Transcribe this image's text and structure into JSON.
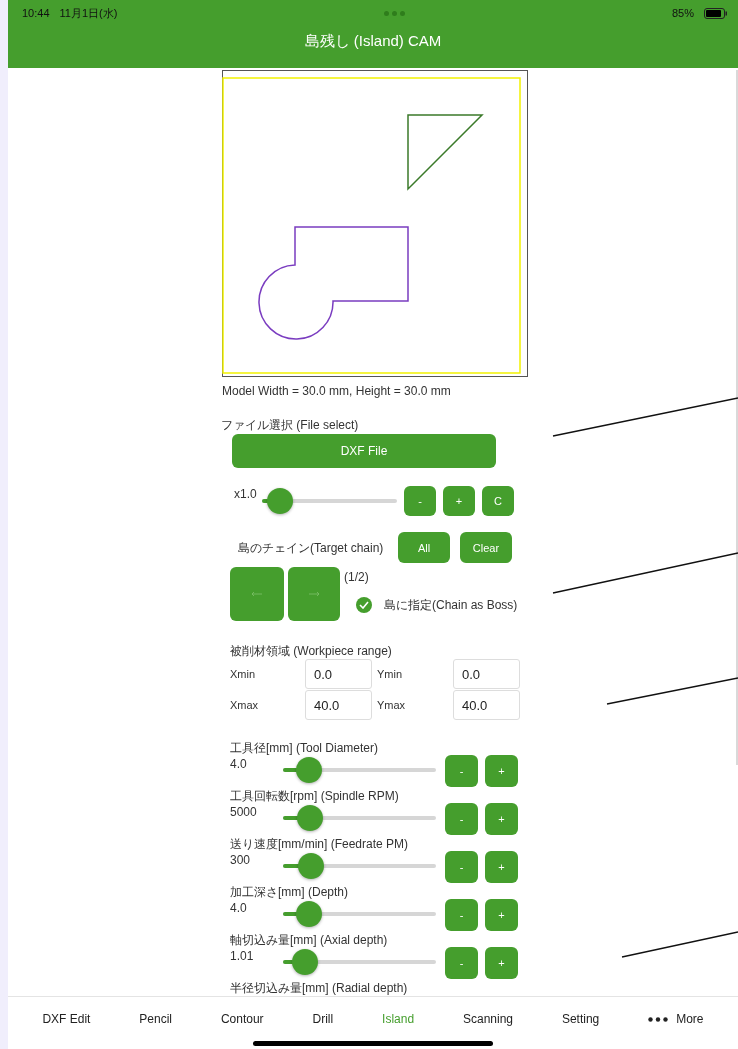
{
  "status_bar": {
    "time": "10:44",
    "date": "11月1日(水)",
    "battery": "85%"
  },
  "header": {
    "title": "島残し (Island) CAM"
  },
  "model_info": "Model Width = 30.0 mm, Height = 30.0 mm",
  "file_select": {
    "label": "ファイル選択 (File select)",
    "button": "DXF File"
  },
  "zoom": {
    "reading": "x1.0",
    "level": 0.05,
    "buttons": [
      "-",
      "+",
      "C"
    ]
  },
  "chain": {
    "label": "島のチェイン(Target chain)",
    "buttons": [
      "All",
      "Clear"
    ],
    "counter": "(1/2)",
    "boss": {
      "label": "島に指定(Chain as Boss)",
      "checked": true
    }
  },
  "workpiece": {
    "label": "被削材領域 (Workpiece range)",
    "fields": [
      {
        "label": "Xmin",
        "value": "0.0"
      },
      {
        "label": "Ymin",
        "value": "0.0"
      },
      {
        "label": "Xmax",
        "value": "40.0"
      },
      {
        "label": "Ymax",
        "value": "40.0"
      }
    ]
  },
  "parameters": [
    {
      "label": "工具径[mm] (Tool Diameter)",
      "reading": "4.0",
      "level": 0.1,
      "buttons": [
        "-",
        "+"
      ]
    },
    {
      "label": "工具回転数[rpm] (Spindle RPM)",
      "reading": "5000",
      "level": 0.11,
      "buttons": [
        "-",
        "+"
      ]
    },
    {
      "label": "送り速度[mm/min] (Feedrate PM)",
      "reading": "300",
      "level": 0.12,
      "buttons": [
        "-",
        "+"
      ]
    },
    {
      "label": "加工深さ[mm] (Depth)",
      "reading": "4.0",
      "level": 0.1,
      "buttons": [
        "-",
        "+"
      ]
    },
    {
      "label": "軸切込み量[mm] (Axial depth)",
      "reading": "1.01",
      "level": 0.07,
      "buttons": [
        "-",
        "+"
      ]
    },
    {
      "label": "半径切込み量[mm] (Radial depth)"
    }
  ],
  "tab_bar": [
    {
      "label": "DXF Edit",
      "selected": false
    },
    {
      "label": "Pencil",
      "selected": false
    },
    {
      "label": "Contour",
      "selected": false
    },
    {
      "label": "Drill",
      "selected": false
    },
    {
      "label": "Island",
      "selected": true
    },
    {
      "label": "Scanning",
      "selected": false
    },
    {
      "label": "Setting",
      "selected": false
    },
    {
      "label": "More",
      "selected": false,
      "kind": "more"
    }
  ]
}
